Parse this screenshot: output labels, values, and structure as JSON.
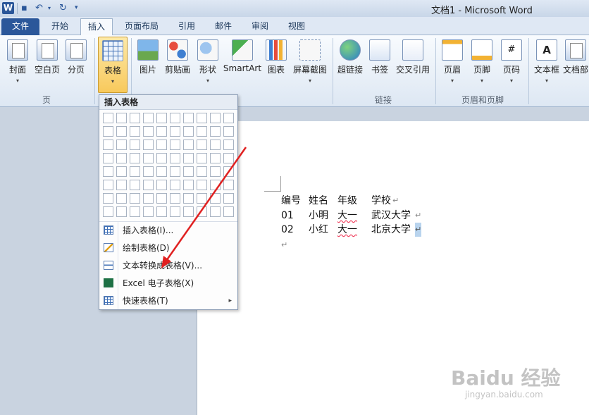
{
  "window": {
    "title": "文档1 - Microsoft Word",
    "logo_letter": "W"
  },
  "tabs": [
    {
      "label": "文件"
    },
    {
      "label": "开始"
    },
    {
      "label": "插入"
    },
    {
      "label": "页面布局"
    },
    {
      "label": "引用"
    },
    {
      "label": "邮件"
    },
    {
      "label": "审阅"
    },
    {
      "label": "视图"
    }
  ],
  "ribbon": {
    "buttons": [
      {
        "label": "封面",
        "arrow": "▾"
      },
      {
        "label": "空白页"
      },
      {
        "label": "分页"
      },
      {
        "label": "表格",
        "arrow": "▾"
      },
      {
        "label": "图片"
      },
      {
        "label": "剪贴画"
      },
      {
        "label": "形状",
        "arrow": "▾"
      },
      {
        "label": "SmartArt"
      },
      {
        "label": "图表"
      },
      {
        "label": "屏幕截图",
        "arrow": "▾"
      },
      {
        "label": "超链接"
      },
      {
        "label": "书签"
      },
      {
        "label": "交叉引用"
      },
      {
        "label": "页眉",
        "arrow": "▾"
      },
      {
        "label": "页脚",
        "arrow": "▾"
      },
      {
        "label": "页码",
        "arrow": "▾"
      },
      {
        "label": "文本框",
        "arrow": "▾"
      },
      {
        "label": "文档部"
      }
    ],
    "groups": [
      {
        "label": "页"
      },
      {
        "label": "链接"
      },
      {
        "label": "页眉和页脚"
      }
    ],
    "icon_chars": {
      "hyperlink": "",
      "pnum": "#",
      "textbox": "A"
    }
  },
  "dropdown": {
    "header": "插入表格",
    "grid_cols": 10,
    "grid_rows": 8,
    "items": [
      {
        "label": "插入表格(I)...",
        "icon": "table-icon"
      },
      {
        "label": "绘制表格(D)",
        "icon": "draw-table-icon"
      },
      {
        "label": "文本转换成表格(V)...",
        "icon": "convert-text-icon"
      },
      {
        "label": "Excel 电子表格(X)",
        "icon": "excel-icon"
      },
      {
        "label": "快速表格(T)",
        "icon": "quick-table-icon",
        "submenu": "▸"
      }
    ]
  },
  "document": {
    "rows": [
      [
        "编号",
        "姓名",
        "年级",
        "学校"
      ],
      [
        "01",
        "小明",
        "大一",
        "武汉大学"
      ],
      [
        "02",
        "小红",
        "大一",
        "北京大学"
      ]
    ],
    "paragraph_mark": "↵"
  },
  "watermark": {
    "big": "Baidu 经验",
    "small": "jingyan.baidu.com"
  },
  "colors": {
    "accent": "#2b579a",
    "arrow": "#e02020"
  }
}
